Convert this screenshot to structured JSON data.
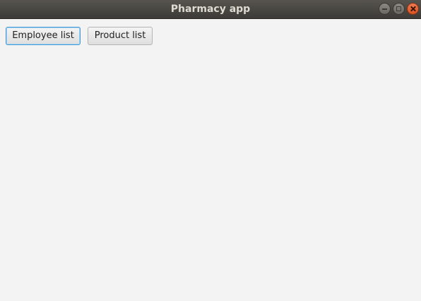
{
  "window": {
    "title": "Pharmacy app",
    "controls": {
      "minimize_icon": "minimize-icon",
      "maximize_icon": "maximize-icon",
      "close_icon": "close-icon"
    }
  },
  "main": {
    "buttons": [
      {
        "label": "Employee list",
        "focused": true
      },
      {
        "label": "Product list",
        "focused": false
      }
    ]
  },
  "colors": {
    "titlebar": "#3d3b37",
    "title_text": "#dfdbd2",
    "close_button": "#e05a24",
    "focus_ring": "#3f9bd6",
    "background": "#f3f3f3"
  }
}
